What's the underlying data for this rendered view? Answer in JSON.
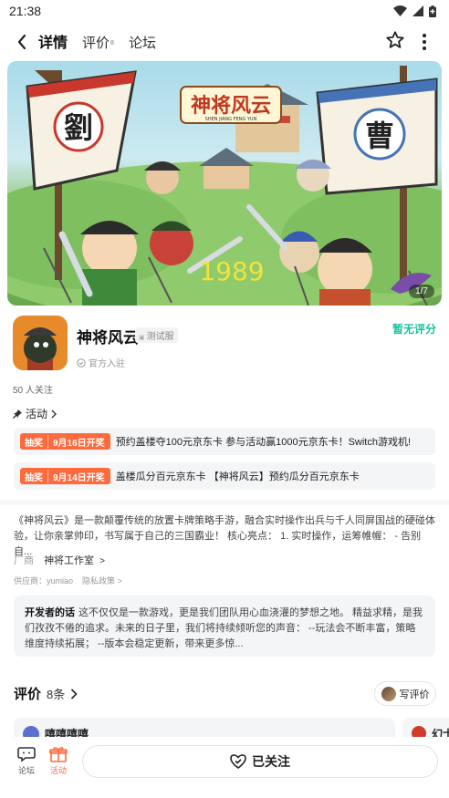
{
  "status_bar": {
    "time": "21:38"
  },
  "nav": {
    "tabs": [
      {
        "label": "详情",
        "active": true
      },
      {
        "label": "评价",
        "badge": "8",
        "active": false
      },
      {
        "label": "论坛",
        "active": false
      }
    ]
  },
  "banner": {
    "counter": "1/7",
    "year_text": "1989",
    "logo_text": "神将风云",
    "logo_subtitle": "SHEN JIANG FENG YUN",
    "flag_left": "劉",
    "flag_right": "曹"
  },
  "game": {
    "title": "神将风云",
    "test_badge": "测试服",
    "official_label": "官方入驻",
    "rating_text": "暂无评分",
    "followers": "50 人关注"
  },
  "activities": {
    "heading": "活动",
    "items": [
      {
        "tag": "抽奖",
        "date": "9月16日开奖",
        "text": "预约盖楼夺100元京东卡 参与活动赢1000元京东卡！Switch游戏机!"
      },
      {
        "tag": "抽奖",
        "date": "9月14日开奖",
        "text": "盖楼瓜分百元京东卡 【神将风云】预约瓜分百元京东卡"
      }
    ]
  },
  "intro": {
    "text": "《神将风云》是一款颠覆传统的放置卡牌策略手游，融合实时操作出兵与千人同屏国战的硬碰体验，让你亲掌帅印，书写属于自己的三国霸业！ 核心亮点： 1. 实时操作，运筹帷幄： - 告别自..."
  },
  "vendor": {
    "label": "厂商",
    "name": "神将工作室"
  },
  "supplier": {
    "text": "供应商：yumiao",
    "privacy": "隐私政策"
  },
  "developer": {
    "label": "开发者的话",
    "text": "这不仅仅是一款游戏，更是我们团队用心血浇灌的梦想之地。 精益求精，是我们孜孜不倦的追求。未来的日子里，我们将持续倾听您的声音： --玩法会不断丰富，策略维度持续拓展； --版本会稳定更新，带来更多惊..."
  },
  "reviews": {
    "heading": "评价",
    "count": "8条",
    "write_label": "写评价",
    "cards": [
      {
        "name": "嘻嘻嘻嘻"
      },
      {
        "name": "幻士"
      }
    ]
  },
  "bottom_bar": {
    "forum_label": "论坛",
    "activity_label": "活动",
    "follow_label": "已关注"
  },
  "colors": {
    "accent": "#16c39e",
    "promo": "#ff6a3d",
    "tab_underline": "#2ed3b0"
  }
}
